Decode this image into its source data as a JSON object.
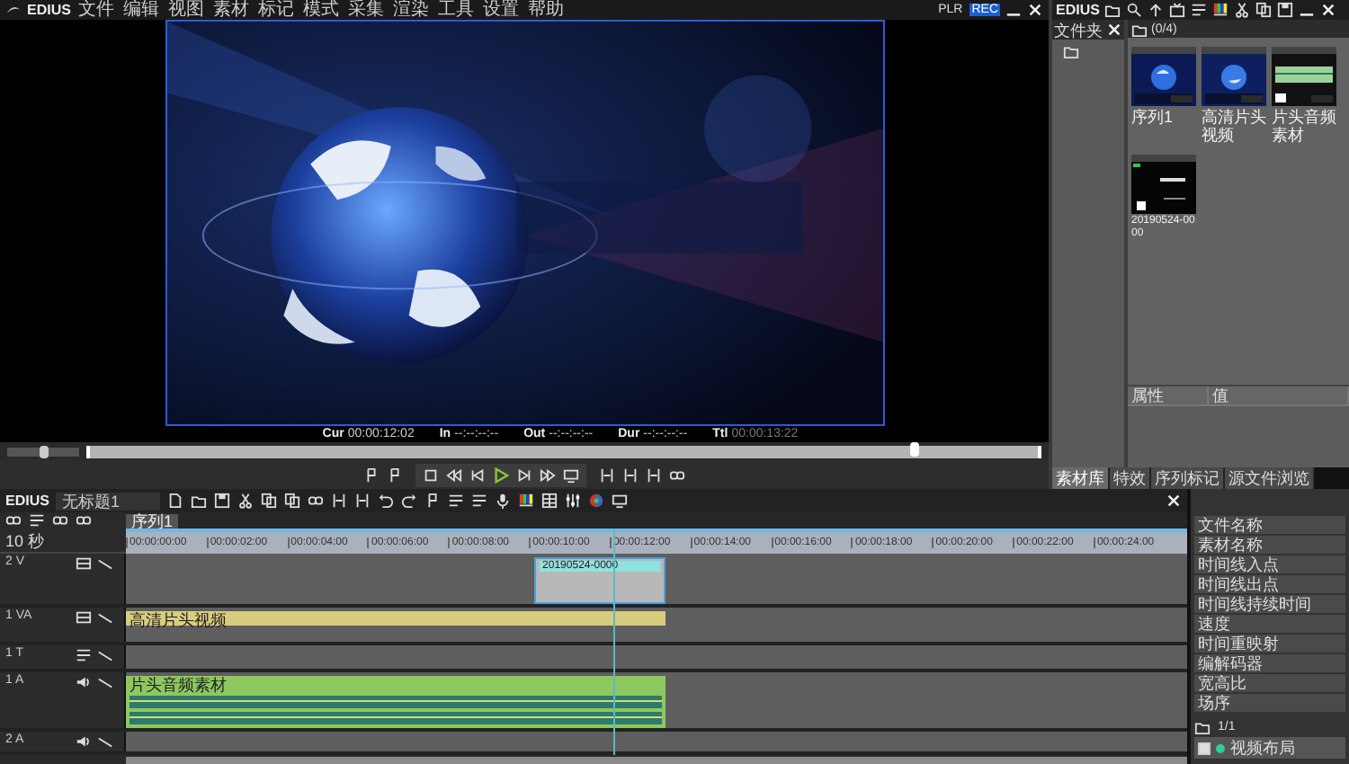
{
  "menu_bar": {
    "logo": "EDIUS",
    "items": [
      "文件",
      "编辑",
      "视图",
      "素材",
      "标记",
      "模式",
      "采集",
      "渲染",
      "工具",
      "设置",
      "帮助"
    ],
    "modes": [
      {
        "label": "PLR",
        "selected": false
      },
      {
        "label": "REC",
        "selected": true
      }
    ]
  },
  "player": {
    "timecodes": [
      {
        "label": "Cur",
        "value": "00:00:12:02",
        "dim": false
      },
      {
        "label": "In",
        "value": "--:--:--:--",
        "dim": false
      },
      {
        "label": "Out",
        "value": "--:--:--:--",
        "dim": false
      },
      {
        "label": "Dur",
        "value": "--:--:--:--",
        "dim": false
      },
      {
        "label": "Ttl",
        "value": "00:00:13:22",
        "dim": true
      }
    ],
    "zoom_slider": {
      "level": 0.5
    },
    "scrubber": {
      "level": 0.87
    }
  },
  "bin": {
    "logo": "EDIUS",
    "folder_tab": "文件夹",
    "count": "(0/4)",
    "clips": [
      {
        "name": "序列1",
        "kind": "sequence"
      },
      {
        "name": "高清片头视频",
        "kind": "video"
      },
      {
        "name": "片头音频素材",
        "kind": "audio"
      },
      {
        "name": "20190524-0000",
        "kind": "title"
      }
    ],
    "columns": [
      "属性",
      "值"
    ],
    "tabs": [
      {
        "label": "素材库",
        "selected": true
      },
      {
        "label": "特效",
        "selected": false
      },
      {
        "label": "序列标记",
        "selected": false
      },
      {
        "label": "源文件浏览",
        "selected": false
      }
    ]
  },
  "timeline": {
    "logo": "EDIUS",
    "project": "无标题1",
    "sequence_tab": "序列1",
    "scale": "10 秒",
    "ruler": [
      "00:00:00:00",
      "00:00:02:00",
      "00:00:04:00",
      "00:00:06:00",
      "00:00:08:00",
      "00:00:10:00",
      "00:00:12:00",
      "00:00:14:00",
      "00:00:16:00",
      "00:00:18:00",
      "00:00:20:00",
      "00:00:22:00",
      "00:00:24:00"
    ],
    "tracks": [
      {
        "name": "2 V",
        "kind": "video",
        "clip": {
          "kind": "title",
          "name": "20190524-0000"
        }
      },
      {
        "name": "1 VA",
        "kind": "va",
        "clip": {
          "kind": "video",
          "name": "高清片头视频"
        }
      },
      {
        "name": "1 T",
        "kind": "title"
      },
      {
        "name": "1 A",
        "kind": "audio",
        "clip": {
          "kind": "audio",
          "name": "片头音频素材"
        }
      },
      {
        "name": "2 A",
        "kind": "audio"
      }
    ]
  },
  "info": {
    "fields": [
      "文件名称",
      "素材名称",
      "时间线入点",
      "时间线出点",
      "时间线持续时间",
      "速度",
      "时间重映射",
      "编解码器",
      "宽高比",
      "场序"
    ],
    "page": "1/1",
    "layers": [
      {
        "name": "视频布局",
        "checked": true
      }
    ]
  }
}
